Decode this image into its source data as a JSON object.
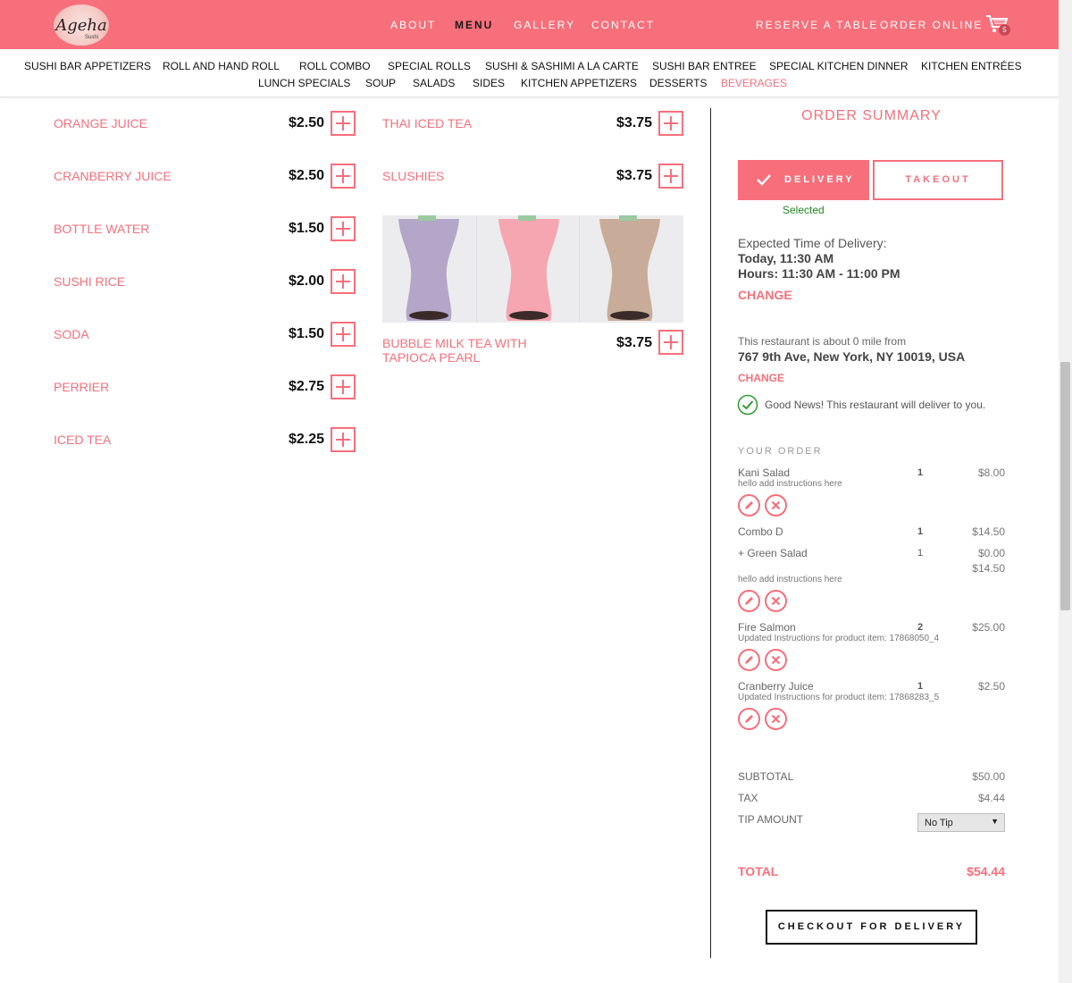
{
  "header": {
    "logo_text": "Ageha",
    "logo_sub": "Sushi",
    "nav": [
      "ABOUT",
      "MENU",
      "GALLERY",
      "CONTACT"
    ],
    "reserve": "RESERVE A TABLE",
    "order_online": "ORDER ONLINE",
    "cart_count": "5"
  },
  "categories": {
    "row1": [
      "SUSHI BAR APPETIZERS",
      "ROLL AND HAND ROLL",
      "ROLL COMBO",
      "SPECIAL ROLLS",
      "SUSHI & SASHIMI A LA CARTE",
      "SUSHI BAR ENTREE",
      "SPECIAL KITCHEN DINNER",
      "KITCHEN ENTRÉES"
    ],
    "row2": [
      "LUNCH SPECIALS",
      "SOUP",
      "SALADS",
      "SIDES",
      "KITCHEN APPETIZERS",
      "DESSERTS",
      "BEVERAGES"
    ]
  },
  "menu": {
    "left": [
      {
        "name": "ORANGE JUICE",
        "price": "$2.50"
      },
      {
        "name": "CRANBERRY JUICE",
        "price": "$2.50"
      },
      {
        "name": "BOTTLE WATER",
        "price": "$1.50"
      },
      {
        "name": "SUSHI RICE",
        "price": "$2.00"
      },
      {
        "name": "SODA",
        "price": "$1.50"
      },
      {
        "name": "PERRIER",
        "price": "$2.75"
      },
      {
        "name": "ICED TEA",
        "price": "$2.25"
      }
    ],
    "right": [
      {
        "name": "THAI ICED TEA",
        "price": "$3.75"
      },
      {
        "name": "SLUSHIES",
        "price": "$3.75"
      },
      {
        "name": "BUBBLE MILK TEA WITH TAPIOCA PEARL",
        "price": "$3.75"
      }
    ]
  },
  "summary": {
    "title": "ORDER SUMMARY",
    "delivery": "DELIVERY",
    "takeout": "TAKEOUT",
    "selected": "Selected",
    "expected_label": "Expected Time of Delivery:",
    "expected_time": "Today, 11:30 AM",
    "hours": "Hours: 11:30 AM - 11:00 PM",
    "change": "CHANGE",
    "distance": "This restaurant is about 0 mile from",
    "address": "767 9th Ave, New York, NY 10019, USA",
    "change2": "CHANGE",
    "good_news": "Good News! This restaurant will deliver to you.",
    "your_order": "YOUR ORDER",
    "items": [
      {
        "name": "Kani Salad",
        "qty": "1",
        "price": "$8.00",
        "note": "hello add instructions here"
      },
      {
        "name": "Combo D",
        "qty": "1",
        "price": "$14.50",
        "sub_name": "+ Green Salad",
        "sub_qty": "1",
        "sub_price": "$0.00",
        "sub_total": "$14.50",
        "note": "hello add instructions here"
      },
      {
        "name": "Fire Salmon",
        "qty": "2",
        "price": "$25.00",
        "note": "Updated Instructions for product item: 17868050_4"
      },
      {
        "name": "Cranberry Juice",
        "qty": "1",
        "price": "$2.50",
        "note": "Updated Instructions for product item: 17868283_5"
      }
    ],
    "subtotal_label": "SUBTOTAL",
    "subtotal": "$50.00",
    "tax_label": "TAX",
    "tax": "$4.44",
    "tip_label": "TIP AMOUNT",
    "tip_value": "No Tip",
    "total_label": "TOTAL",
    "total": "$54.44",
    "checkout": "CHECKOUT FOR DELIVERY"
  },
  "colors": {
    "accent": "#f76f7b",
    "success": "#1f8a1f"
  },
  "icons": [
    "cart-icon",
    "check-icon",
    "edit-icon",
    "remove-icon",
    "success-check-icon"
  ]
}
